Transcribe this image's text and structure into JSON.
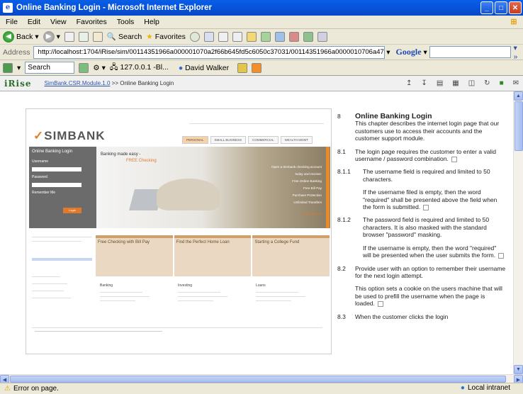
{
  "window": {
    "title": "Online Banking Login - Microsoft Internet Explorer"
  },
  "menu": [
    "File",
    "Edit",
    "View",
    "Favorites",
    "Tools",
    "Help"
  ],
  "toolbar": {
    "back": "Back",
    "search": "Search",
    "favorites": "Favorites"
  },
  "address": {
    "label": "Address",
    "url": "http://localhost:1704/iRise/sim/00114351966a000001070a2f66b645fd5c6050c37031/00114351966a0000010706a479772ab9d3a7be",
    "google_label": "Google"
  },
  "links": {
    "search_value": "Search",
    "ip": "127.0.0.1 -Bl...",
    "user": "David Walker"
  },
  "irise": {
    "logo": "iRise",
    "breadcrumb_link": "SimBank.CSR.Module.1.0",
    "breadcrumb_current": ">> Online Banking Login"
  },
  "mock": {
    "brand": "SIMBANK",
    "tabs": [
      "PERSONAL",
      "SMALL BUSINESS",
      "COMMERCIAL",
      "WEALTH MGMT"
    ],
    "login_title": "Online Banking Login",
    "username": "Username",
    "password": "Password",
    "remember": "Remember Me",
    "login_btn": "Login",
    "hero_left": "Banking made easy -",
    "hero_left2": "FREE Checking",
    "hero_lines": [
      "Open a Simbank checking account",
      "today and receive:",
      "Free Online Banking",
      "Free Bill Pay",
      "Purchase Protection",
      "Unlimited Transfers"
    ],
    "signup": "> sign up now!",
    "cols": [
      "Free Checking with Bill Pay",
      "Find the Perfect Home Loan",
      "Starting a College Fund"
    ],
    "sections": [
      "Banking",
      "Investing",
      "Loans"
    ]
  },
  "doc": {
    "items": [
      {
        "num": "8",
        "text": "Online Banking Login",
        "heading": true
      },
      {
        "num": "",
        "text": "This chapter describes the internet login page that our customers use to access their accounts and the customer support module."
      },
      {
        "num": "8.1",
        "text": "The login page requires the customer to enter a valid username / password combination."
      },
      {
        "num": "8.1.1",
        "text": "The username field is required and limited to 50 characters."
      },
      {
        "num": "",
        "text": "If the username filed is empty, then the word \"required\" shall be presented above the field when the form is submitted."
      },
      {
        "num": "8.1.2",
        "text": "The password field is required and limited to 50 characters.  It is also masked with the standard browser \"password\" masking."
      },
      {
        "num": "",
        "text": "If the username is empty, then the word \"required\" will be presented when the user submits the form."
      },
      {
        "num": "8.2",
        "text": "Provide user with an option to remember their username for the next login attempt."
      },
      {
        "num": "",
        "text": "This option sets a cookie on the users machine that will be used to prefill the username when the page is loaded."
      },
      {
        "num": "8.3",
        "text": "When the customer clicks the login"
      }
    ]
  },
  "status": {
    "left": "Error on page.",
    "right": "Local intranet"
  }
}
